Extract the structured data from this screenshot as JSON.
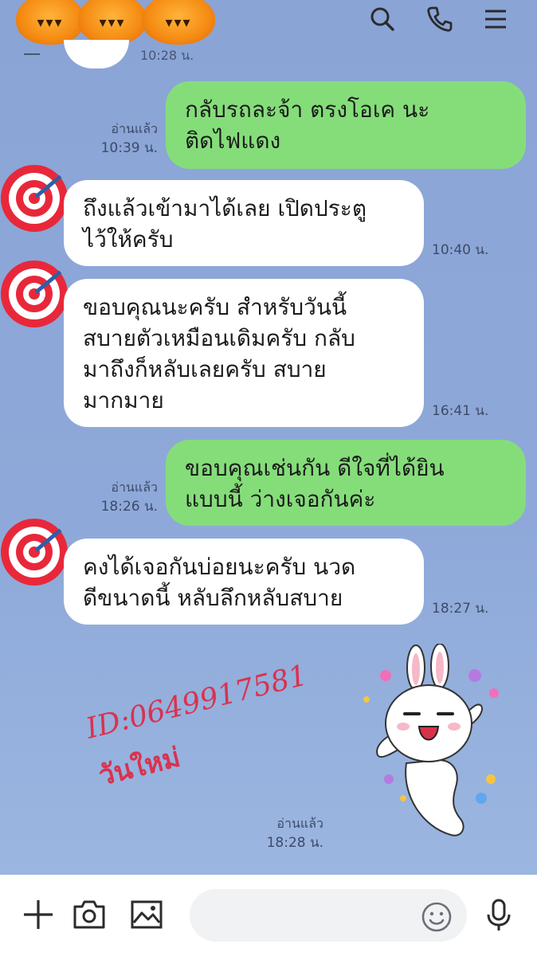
{
  "header": {
    "decoration": "pumpkin-icons",
    "pumpkin_faces": [
      "▾▾▾",
      "▾▾▾",
      "▾▾▾"
    ],
    "icons": [
      "search-icon",
      "phone-icon",
      "menu-icon"
    ]
  },
  "colors": {
    "chat_background": "#8fa8d8",
    "outgoing_bubble": "#85dd7a",
    "incoming_bubble": "#ffffff",
    "watermark": "#d9324f"
  },
  "partial_top_time": "10:28 น.",
  "messages": [
    {
      "direction": "outgoing",
      "lines": [
        "กลับรถละจ้า ตรงโอเค นะ",
        "ติดไฟแดง"
      ],
      "read_label": "อ่านแล้ว",
      "time": "10:39 น."
    },
    {
      "direction": "incoming",
      "lines": [
        "ถึงแล้วเข้ามาได้เลย เปิดประตู",
        "ไว้ให้ครับ"
      ],
      "time": "10:40 น."
    },
    {
      "direction": "incoming",
      "lines": [
        "ขอบคุณนะครับ สำหรับวันนี้",
        "สบายตัวเหมือนเดิมครับ กลับ",
        "มาถึงก็หลับเลยครับ สบาย",
        "มากมาย"
      ],
      "time": "16:41 น."
    },
    {
      "direction": "outgoing",
      "lines": [
        "ขอบคุณเช่นกัน ดีใจที่ได้ยิน",
        "แบบนี้ ว่างเจอกันค่ะ"
      ],
      "read_label": "อ่านแล้ว",
      "time": "18:26 น."
    },
    {
      "direction": "incoming",
      "lines": [
        "คงได้เจอกันบ่อยนะครับ นวด",
        "ดีขนาดนี้ หลับลึกหลับสบาย"
      ],
      "time": "18:27 น."
    }
  ],
  "sticker": {
    "icon": "bunny-sticker-icon",
    "read_label": "อ่านแล้ว",
    "time": "18:28 น."
  },
  "watermark": {
    "line1": "ID:0649917581",
    "line2": "วันใหม่"
  },
  "input_bar": {
    "placeholder": "",
    "icons": [
      "plus-icon",
      "camera-icon",
      "image-icon",
      "emoji-icon",
      "microphone-icon"
    ]
  }
}
